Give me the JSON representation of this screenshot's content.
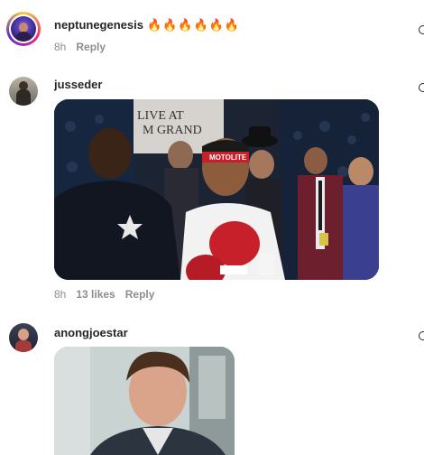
{
  "comments": [
    {
      "username": "neptunegenesis",
      "text": "🔥🔥🔥🔥🔥🔥",
      "time": "8h",
      "likes": "",
      "reply_label": "Reply"
    },
    {
      "username": "jusseder",
      "text": "",
      "time": "8h",
      "likes": "13 likes",
      "reply_label": "Reply",
      "media": {
        "banner_line1": "LIVE AT",
        "banner_line2": "M GRAND",
        "headband": "MOTOLITE"
      }
    },
    {
      "username": "anongjoestar",
      "text": "",
      "time": "",
      "likes": "",
      "reply_label": ""
    }
  ],
  "colors": {
    "story_ring_start": "#f9ce34",
    "story_ring_mid": "#ee2a7b",
    "story_ring_end": "#6228d7",
    "meta_text": "#8e8e8e",
    "glove_red": "#c8202a"
  }
}
